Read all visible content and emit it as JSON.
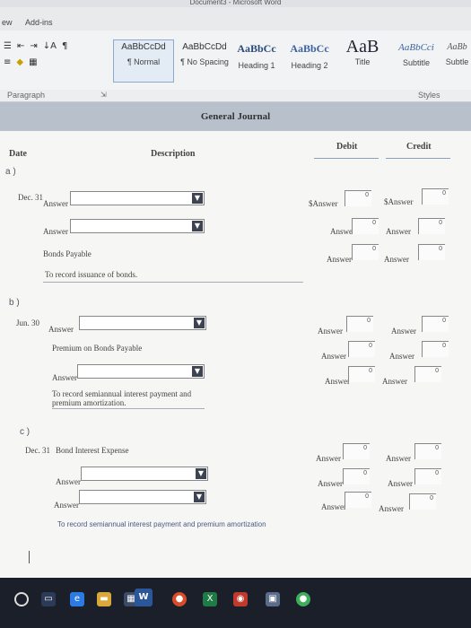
{
  "window": {
    "title": "Document3 - Microsoft Word"
  },
  "ribbon": {
    "tabs": [
      "ew",
      "Add-ins"
    ],
    "paragraph_tools": [
      "¶",
      "↓A",
      "⇤",
      "⇥",
      "≡",
      "▦"
    ],
    "styles": [
      {
        "sample": "AaBbCcDd",
        "label": "¶ Normal",
        "selected": true
      },
      {
        "sample": "AaBbCcDd",
        "label": "¶ No Spacing",
        "selected": false
      },
      {
        "sample": "AaBbCc",
        "label": "Heading 1",
        "selected": false
      },
      {
        "sample": "AaBbCc",
        "label": "Heading 2",
        "selected": false
      },
      {
        "sample": "AaB",
        "label": "Title",
        "selected": false
      },
      {
        "sample": "AaBbCci",
        "label": "Subtitle",
        "selected": false
      },
      {
        "sample": "AaBb",
        "label": "Subtle",
        "selected": false
      }
    ],
    "group_paragraph": "Paragraph",
    "group_styles": "Styles"
  },
  "journal": {
    "title": "General Journal",
    "col_date": "Date",
    "col_description": "Description",
    "col_debit": "Debit",
    "col_credit": "Credit",
    "sections": {
      "a": {
        "label": "a )",
        "date": "Dec. 31",
        "line1_prefix": "Answer",
        "line2_prefix": "Answer",
        "line3_text": "Bonds Payable",
        "note": "To record issuance of bonds.",
        "debit1": "$Answer",
        "credit1": "$Answer",
        "debit2": "Answer",
        "credit2": "Answer",
        "debit3": "Answer",
        "credit3": "Answer"
      },
      "b": {
        "label": "b )",
        "date": "Jun. 30",
        "line1_prefix": "Answer",
        "line2_text": "Premium on Bonds Payable",
        "line3_prefix": "Answer",
        "note1": "To record semiannual interest payment and",
        "note2": "premium amortization.",
        "debit1": "Answer",
        "credit1": "Answer",
        "debit2": "Answer",
        "credit2": "Answer",
        "debit3": "Answer",
        "credit3": "Answer"
      },
      "c": {
        "label": "c )",
        "date": "Dec. 31",
        "line1_text": "Bond Interest Expense",
        "line2_prefix": "Answer",
        "line3_prefix": "Answer",
        "note": "To record semiannual interest payment and premium amortization",
        "debit1": "Answer",
        "credit1": "Answer",
        "debit2": "Answer",
        "credit2": "Answer",
        "debit3": "Answer",
        "credit3": "Answer"
      }
    },
    "zero": "0"
  },
  "taskbar": {
    "word_label": "W"
  }
}
